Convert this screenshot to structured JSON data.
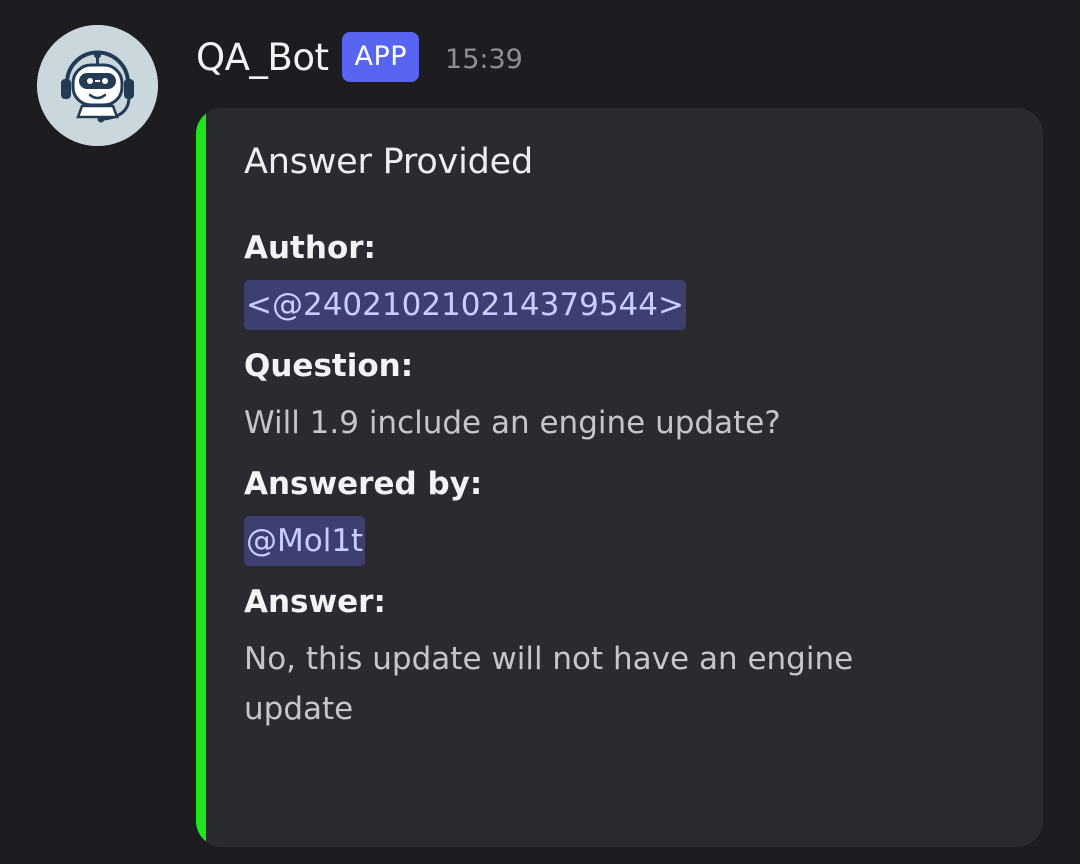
{
  "message": {
    "author": "QA_Bot",
    "badge": "APP",
    "timestamp": "15:39",
    "avatar_icon": "robot-headset-icon"
  },
  "embed": {
    "accent_color": "#1fe51b",
    "title": "Answer Provided",
    "fields": {
      "author": {
        "name": "Author:",
        "value": "<@240210210214379544>"
      },
      "question": {
        "name": "Question:",
        "value": "Will 1.9 include an engine update?"
      },
      "answered_by": {
        "name": "Answered by:",
        "value": "@Mol1t"
      },
      "answer": {
        "name": "Answer:",
        "value": "No, this update will not have an engine update"
      }
    }
  },
  "colors": {
    "background": "#1c1c21",
    "embed_background": "#2a2a31",
    "badge": "#5865f2",
    "mention_bg": "#3c3f6f",
    "mention_text": "#c9ceff"
  }
}
